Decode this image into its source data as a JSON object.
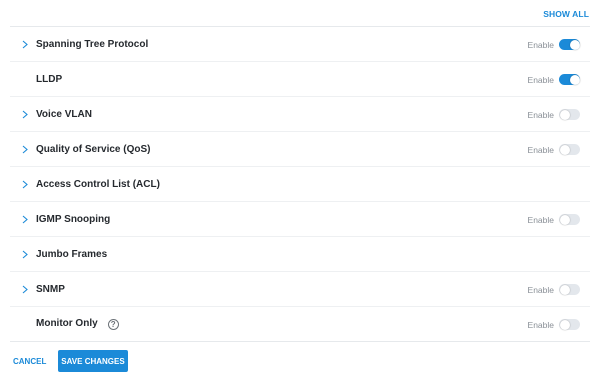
{
  "header": {
    "show_all_label": "SHOW ALL"
  },
  "rows": [
    {
      "label": "Spanning Tree Protocol",
      "expandable": true,
      "enable_label": "Enable",
      "toggle": "on"
    },
    {
      "label": "LLDP",
      "expandable": false,
      "enable_label": "Enable",
      "toggle": "on"
    },
    {
      "label": "Voice VLAN",
      "expandable": true,
      "enable_label": "Enable",
      "toggle": "off"
    },
    {
      "label": "Quality of Service (QoS)",
      "expandable": true,
      "enable_label": "Enable",
      "toggle": "off"
    },
    {
      "label": "Access Control List (ACL)",
      "expandable": true,
      "enable_label": "",
      "toggle": "none"
    },
    {
      "label": "IGMP Snooping",
      "expandable": true,
      "enable_label": "Enable",
      "toggle": "off"
    },
    {
      "label": "Jumbo Frames",
      "expandable": true,
      "enable_label": "",
      "toggle": "none"
    },
    {
      "label": "SNMP",
      "expandable": true,
      "enable_label": "Enable",
      "toggle": "off"
    },
    {
      "label": "Monitor Only",
      "expandable": false,
      "help_icon": "?",
      "enable_label": "Enable",
      "toggle": "off"
    }
  ],
  "footer": {
    "cancel_label": "CANCEL",
    "save_label": "SAVE CHANGES"
  },
  "colors": {
    "accent": "#1b8ad8",
    "toggle_off": "#e3e7ec",
    "text": "#25292e",
    "muted": "#8a9097"
  }
}
